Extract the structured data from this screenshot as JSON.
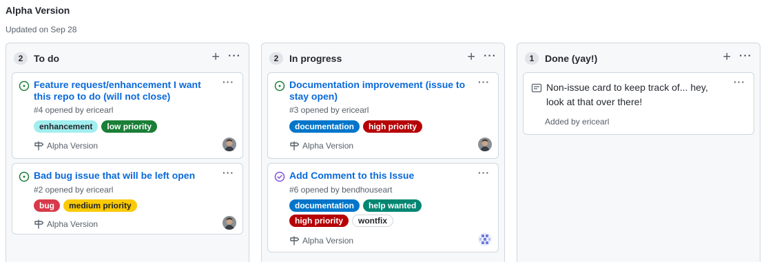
{
  "project": {
    "title": "Alpha Version",
    "updated": "Updated on Sep 28"
  },
  "columns": [
    {
      "count": "2",
      "name": "To do",
      "cards": [
        {
          "title": "Feature request/enhancement I want this repo to do (will not close)",
          "meta": "#4 opened by ericearl",
          "labels": [
            {
              "text": "enhancement",
              "bg": "#a2eeef",
              "fg": "#1f2328"
            },
            {
              "text": "low priority",
              "bg": "#1a7f37",
              "fg": "#ffffff"
            }
          ],
          "project": "Alpha Version"
        },
        {
          "title": "Bad bug issue that will be left open",
          "meta": "#2 opened by ericearl",
          "labels": [
            {
              "text": "bug",
              "bg": "#d73a4a",
              "fg": "#ffffff"
            },
            {
              "text": "medium priority",
              "bg": "#fbca04",
              "fg": "#1f2328"
            }
          ],
          "project": "Alpha Version"
        }
      ]
    },
    {
      "count": "2",
      "name": "In progress",
      "cards": [
        {
          "title": "Documentation improvement (issue to stay open)",
          "meta": "#3 opened by ericearl",
          "labels": [
            {
              "text": "documentation",
              "bg": "#0075ca",
              "fg": "#ffffff"
            },
            {
              "text": "high priority",
              "bg": "#b60205",
              "fg": "#ffffff"
            }
          ],
          "project": "Alpha Version"
        },
        {
          "title": "Add Comment to this Issue",
          "meta": "#6 opened by bendhouseart",
          "labels": [
            {
              "text": "documentation",
              "bg": "#0075ca",
              "fg": "#ffffff"
            },
            {
              "text": "help wanted",
              "bg": "#008672",
              "fg": "#ffffff"
            },
            {
              "text": "high priority",
              "bg": "#b60205",
              "fg": "#ffffff"
            },
            {
              "text": "wontfix",
              "bg": "#ffffff",
              "fg": "#1f2328"
            }
          ],
          "project": "Alpha Version"
        }
      ]
    },
    {
      "count": "1",
      "name": "Done (yay!)",
      "note": {
        "text": "Non-issue card to keep track of... hey, look at that over there!",
        "added_by": "Added by ericearl"
      }
    }
  ],
  "colors": {
    "open": "#1a7f37",
    "closed": "#8250df",
    "link": "#0969da"
  },
  "icons": {
    "open_issue": "issue-opened-icon",
    "closed_issue": "issue-closed-icon",
    "project": "project-signpost-icon",
    "note": "note-icon"
  }
}
